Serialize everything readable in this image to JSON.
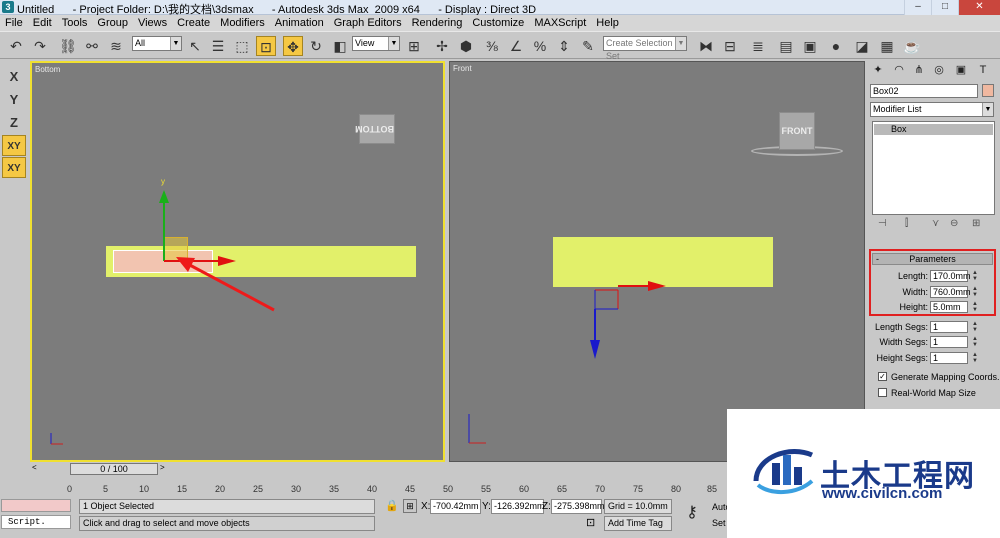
{
  "window": {
    "title": "Untitled      - Project Folder: D:\\我的文档\\3dsmax      - Autodesk 3ds Max  2009 x64      - Display : Direct 3D",
    "min": "–",
    "max": "□",
    "close": "✕"
  },
  "menu": [
    "File",
    "Edit",
    "Tools",
    "Group",
    "Views",
    "Create",
    "Modifiers",
    "Animation",
    "Graph Editors",
    "Rendering",
    "Customize",
    "MAXScript",
    "Help"
  ],
  "toolbar": {
    "selection_filter": "All",
    "reference_coord": "View",
    "named_selection_placeholder": "Create Selection Set"
  },
  "axis_buttons": [
    "X",
    "Y",
    "Z",
    "XY",
    "XY"
  ],
  "viewports": {
    "left": {
      "label": "Bottom",
      "cube_label": "BOTTOM",
      "gizmo_y_label": "y"
    },
    "right": {
      "label": "Front",
      "cube_label": "FRONT"
    }
  },
  "command_panel": {
    "object_name": "Box02",
    "object_color": "#f0b8a0",
    "modifier_list": "Modifier List",
    "stack_item": "Box",
    "rollout_title": "Parameters",
    "rollout_toggle": "-",
    "params": [
      {
        "label": "Length:",
        "value": "170.0mm"
      },
      {
        "label": "Width:",
        "value": "760.0mm"
      },
      {
        "label": "Height:",
        "value": "5.0mm"
      }
    ],
    "segs": [
      {
        "label": "Length Segs:",
        "value": "1"
      },
      {
        "label": "Width Segs:",
        "value": "1"
      },
      {
        "label": "Height Segs:",
        "value": "1"
      }
    ],
    "generate_mapping": {
      "label": "Generate Mapping Coords.",
      "checked": "✓"
    },
    "real_world": {
      "label": "Real-World Map Size",
      "checked": ""
    }
  },
  "timeline": {
    "slider": "0 / 100",
    "prev": "<",
    "next": ">",
    "ticks": [
      "0",
      "5",
      "10",
      "15",
      "20",
      "25",
      "30",
      "35",
      "40",
      "45",
      "50",
      "55",
      "60",
      "65",
      "70",
      "75",
      "80",
      "85"
    ]
  },
  "status": {
    "selection": "1 Object Selected",
    "prompt": "Click and drag to select and move objects",
    "x_label": "X:",
    "x": "-700.42mm",
    "y_label": "Y:",
    "y": "-126.392mm",
    "z_label": "Z:",
    "z": "-275.398mm",
    "grid": "Grid = 10.0mm",
    "add_time_tag": "Add Time Tag",
    "auto": "Auto",
    "set": "Set",
    "script": "Script."
  },
  "watermark": {
    "name": "土木工程网",
    "url": "www.civilcn.com"
  },
  "colors": {
    "box_fill": "#e2f06a",
    "selected_box": "#f2c4b0",
    "viewport_bg": "#7c7c7c",
    "active_border": "#f0e030",
    "highlight": "#e02020"
  }
}
